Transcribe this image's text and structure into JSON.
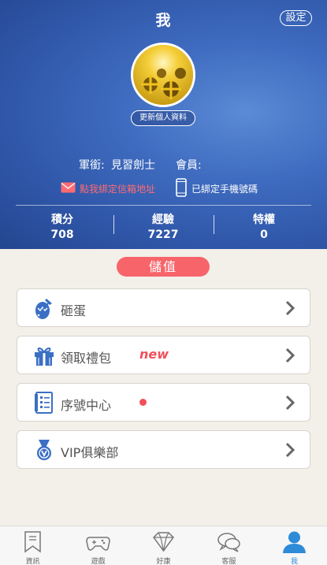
{
  "header": {
    "title": "我",
    "settings_label": "設定",
    "update_profile_label": "更新個人資料",
    "rank_label": "軍銜:",
    "rank_value": "見習劍士",
    "member_label": "會員:",
    "member_value": "",
    "bind_email_label": "點我綁定信箱地址",
    "bind_phone_label": "已綁定手機號碼"
  },
  "stats": [
    {
      "label": "積分",
      "value": "708"
    },
    {
      "label": "經驗",
      "value": "7227"
    },
    {
      "label": "特權",
      "value": "0"
    }
  ],
  "recharge_label": "儲值",
  "menu": [
    {
      "label": "砸蛋",
      "icon": "egg-icon"
    },
    {
      "label": "領取禮包",
      "icon": "gift-icon",
      "tag": "new"
    },
    {
      "label": "序號中心",
      "icon": "serial-icon",
      "dot": true
    },
    {
      "label": "VIP俱樂部",
      "icon": "vip-medal-icon"
    }
  ],
  "nav": [
    {
      "label": "資訊",
      "icon": "bookmark-icon",
      "active": false
    },
    {
      "label": "遊戲",
      "icon": "gamepad-icon",
      "active": false
    },
    {
      "label": "好康",
      "icon": "diamond-icon",
      "active": false
    },
    {
      "label": "客服",
      "icon": "chat-bubble-icon",
      "active": false
    },
    {
      "label": "我",
      "icon": "user-icon",
      "active": true
    }
  ],
  "colors": {
    "accent_red": "#f7646a",
    "header_blue": "#3f6cc0",
    "icon_blue": "#3a6fc4",
    "active_nav": "#2e8bd8"
  }
}
